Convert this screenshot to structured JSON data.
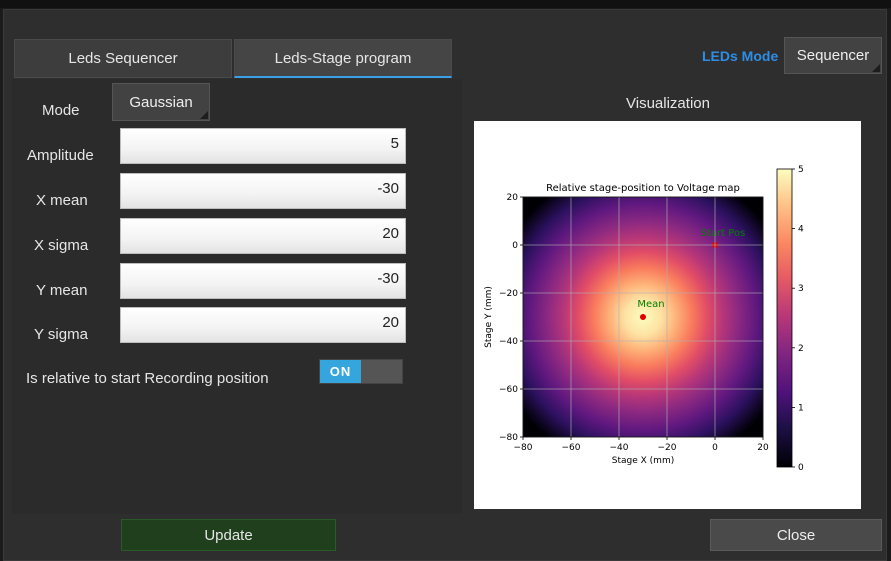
{
  "tabs": [
    {
      "label": "Leds Sequencer",
      "active": false
    },
    {
      "label": "Leds-Stage program",
      "active": true
    }
  ],
  "leds_mode": {
    "label": "LEDs Mode",
    "value": "Sequencer"
  },
  "form": {
    "mode_label": "Mode",
    "mode_value": "Gaussian",
    "fields": [
      {
        "label": "Amplitude",
        "value": "5"
      },
      {
        "label": "X mean",
        "value": "-30"
      },
      {
        "label": "X sigma",
        "value": "20"
      },
      {
        "label": "Y mean",
        "value": "-30"
      },
      {
        "label": "Y sigma",
        "value": "20"
      }
    ],
    "relative_label": "Is relative to start Recording position",
    "relative_toggle": "ON"
  },
  "visualization": {
    "title": "Visualization"
  },
  "buttons": {
    "update": "Update",
    "close": "Close"
  },
  "colors": {
    "accent": "#2d8ee6",
    "toggle_on": "#35a6dd",
    "update_bg": "#1f3f1d"
  },
  "chart_data": {
    "type": "heatmap",
    "title": "Relative stage-position to Voltage map",
    "xlabel": "Stage X (mm)",
    "ylabel": "Stage Y (mm)",
    "xlim": [
      -80,
      20
    ],
    "ylim": [
      -80,
      20
    ],
    "x_ticks": [
      "−80",
      "−60",
      "−40",
      "−20",
      "0",
      "20"
    ],
    "y_ticks": [
      "20",
      "0",
      "−20",
      "−40",
      "−60",
      "−80"
    ],
    "colorbar_ticks": [
      "0",
      "1",
      "2",
      "3",
      "4",
      "5"
    ],
    "colormap": "magma",
    "gaussian": {
      "amplitude": 5,
      "x_mean": -30,
      "x_sigma": 20,
      "y_mean": -30,
      "y_sigma": 20
    },
    "points": [
      {
        "label": "Mean",
        "x": -30,
        "y": -30,
        "color": "#e00000"
      },
      {
        "label": "Start Pos",
        "x": 0,
        "y": 0,
        "color": "#e00000"
      }
    ],
    "grid": true
  }
}
